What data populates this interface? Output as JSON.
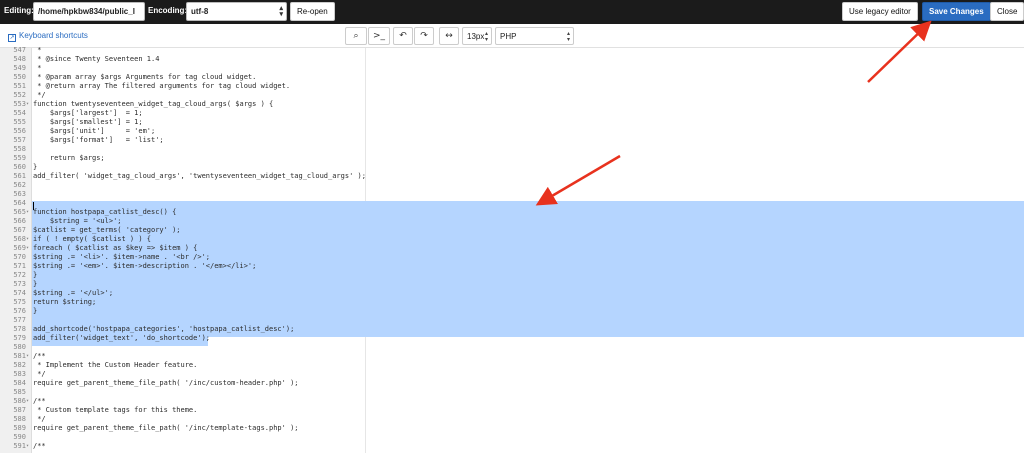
{
  "topbar": {
    "editing_label": "Editing:",
    "path_value": "/home/hpkbw834/public_l",
    "encoding_label": "Encoding:",
    "encoding_value": "utf-8",
    "reopen_label": "Re-open",
    "legacy_label": "Use legacy editor",
    "save_label": "Save Changes",
    "close_label": "Close"
  },
  "toolbar": {
    "shortcuts_label": "Keyboard shortcuts",
    "buttons": [
      {
        "name": "search-button",
        "glyph": "⌕"
      },
      {
        "name": "terminal-button",
        "glyph": ">_"
      },
      {
        "name": "undo-button",
        "glyph": "↶"
      },
      {
        "name": "redo-button",
        "glyph": "↷"
      },
      {
        "name": "wrap-toggle-button",
        "glyph": "↔"
      }
    ],
    "font_size": "13px",
    "mode": "PHP"
  },
  "editor": {
    "lines": [
      {
        "n": "547",
        "fold": "",
        "text": " *"
      },
      {
        "n": "548",
        "fold": "",
        "text": " * @since Twenty Seventeen 1.4"
      },
      {
        "n": "549",
        "fold": "",
        "text": " *"
      },
      {
        "n": "550",
        "fold": "",
        "text": " * @param array $args Arguments for tag cloud widget."
      },
      {
        "n": "551",
        "fold": "",
        "text": " * @return array The filtered arguments for tag cloud widget."
      },
      {
        "n": "552",
        "fold": "",
        "text": " */"
      },
      {
        "n": "553",
        "fold": "▾",
        "text": "function twentyseventeen_widget_tag_cloud_args( $args ) {"
      },
      {
        "n": "554",
        "fold": "",
        "text": "    $args['largest']  = 1;"
      },
      {
        "n": "555",
        "fold": "",
        "text": "    $args['smallest'] = 1;"
      },
      {
        "n": "556",
        "fold": "",
        "text": "    $args['unit']     = 'em';"
      },
      {
        "n": "557",
        "fold": "",
        "text": "    $args['format']   = 'list';"
      },
      {
        "n": "558",
        "fold": "",
        "text": ""
      },
      {
        "n": "559",
        "fold": "",
        "text": "    return $args;"
      },
      {
        "n": "560",
        "fold": "",
        "text": "}"
      },
      {
        "n": "561",
        "fold": "",
        "text": "add_filter( 'widget_tag_cloud_args', 'twentyseventeen_widget_tag_cloud_args' );"
      },
      {
        "n": "562",
        "fold": "",
        "text": ""
      },
      {
        "n": "563",
        "fold": "",
        "text": ""
      },
      {
        "n": "564",
        "fold": "",
        "text": ""
      },
      {
        "n": "565",
        "fold": "▾",
        "text": "function hostpapa_catlist_desc() {"
      },
      {
        "n": "566",
        "fold": "",
        "text": "    $string = '<ul>';"
      },
      {
        "n": "567",
        "fold": "",
        "text": "$catlist = get_terms( 'category' );"
      },
      {
        "n": "568",
        "fold": "▾",
        "text": "if ( ! empty( $catlist ) ) {"
      },
      {
        "n": "569",
        "fold": "▾",
        "text": "foreach ( $catlist as $key => $item ) {"
      },
      {
        "n": "570",
        "fold": "",
        "text": "$string .= '<li>'. $item->name . '<br />';"
      },
      {
        "n": "571",
        "fold": "",
        "text": "$string .= '<em>'. $item->description . '</em></li>';"
      },
      {
        "n": "572",
        "fold": "",
        "text": "}"
      },
      {
        "n": "573",
        "fold": "",
        "text": "}"
      },
      {
        "n": "574",
        "fold": "",
        "text": "$string .= '</ul>';"
      },
      {
        "n": "575",
        "fold": "",
        "text": "return $string;"
      },
      {
        "n": "576",
        "fold": "",
        "text": "}"
      },
      {
        "n": "577",
        "fold": "",
        "text": ""
      },
      {
        "n": "578",
        "fold": "",
        "text": "add_shortcode('hostpapa_categories', 'hostpapa_catlist_desc');"
      },
      {
        "n": "579",
        "fold": "",
        "text": "add_filter('widget_text', 'do_shortcode');"
      },
      {
        "n": "580",
        "fold": "",
        "text": ""
      },
      {
        "n": "581",
        "fold": "▾",
        "text": "/**"
      },
      {
        "n": "582",
        "fold": "",
        "text": " * Implement the Custom Header feature."
      },
      {
        "n": "583",
        "fold": "",
        "text": " */"
      },
      {
        "n": "584",
        "fold": "",
        "text": "require get_parent_theme_file_path( '/inc/custom-header.php' );"
      },
      {
        "n": "585",
        "fold": "",
        "text": ""
      },
      {
        "n": "586",
        "fold": "▾",
        "text": "/**"
      },
      {
        "n": "587",
        "fold": "",
        "text": " * Custom template tags for this theme."
      },
      {
        "n": "588",
        "fold": "",
        "text": " */"
      },
      {
        "n": "589",
        "fold": "",
        "text": "require get_parent_theme_file_path( '/inc/template-tags.php' );"
      },
      {
        "n": "590",
        "fold": "",
        "text": ""
      },
      {
        "n": "591",
        "fold": "▾",
        "text": "/**"
      }
    ]
  },
  "colors": {
    "topbar_bg": "#1b1b1b",
    "save_button": "#2a6cc1",
    "selection": "#b5d5ff",
    "annotation_arrow": "#e8321e"
  }
}
